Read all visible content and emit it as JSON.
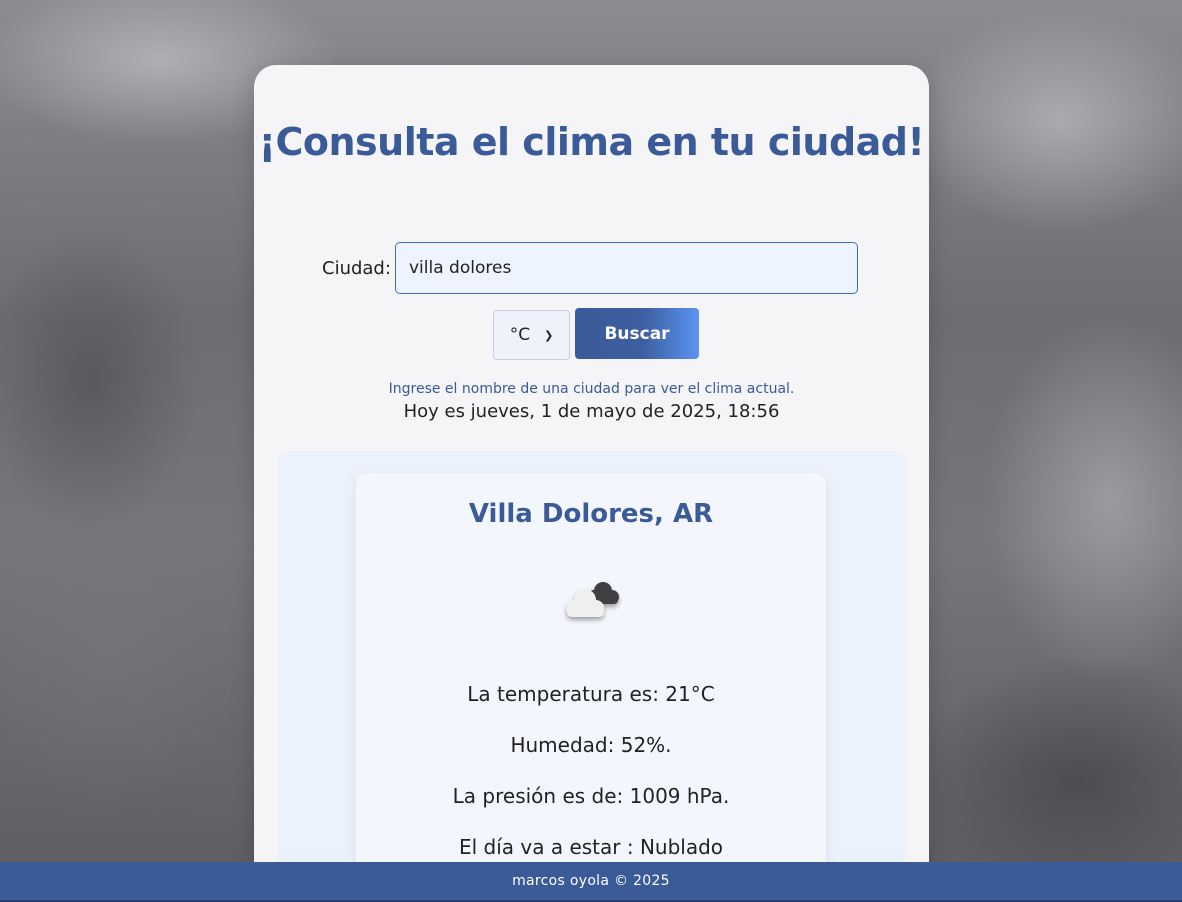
{
  "header": {
    "title": "¡Consulta el clima en tu ciudad!"
  },
  "search": {
    "city_label": "Ciudad:",
    "city_value": "villa dolores",
    "unit_selected": "°C",
    "button_label": "Buscar",
    "hint": "Ingrese el nombre de una ciudad para ver el clima actual."
  },
  "date_line": "Hoy es jueves, 1 de mayo de 2025, 18:56",
  "weather": {
    "city": "Villa Dolores, AR",
    "icon": "cloudy-icon",
    "temperature": "La temperatura es: 21°C",
    "humidity": "Humedad: 52%.",
    "pressure": "La presión es de: 1009 hPa.",
    "description": "El día va a estar : Nublado"
  },
  "footer": {
    "text": "marcos oyola © 2025"
  },
  "colors": {
    "primary": "#3a5a98",
    "button_gradient_end": "#5b94f2",
    "card_bg": "#f5f5f7",
    "result_bg": "#ecf2fd"
  }
}
